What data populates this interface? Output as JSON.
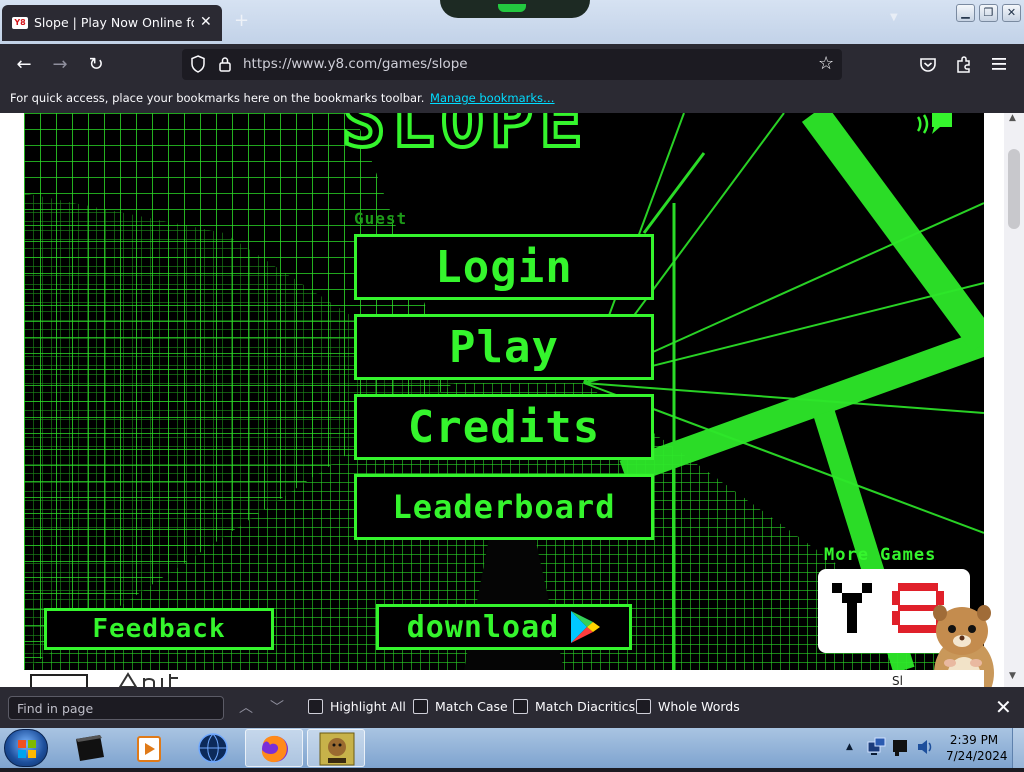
{
  "browser": {
    "tab": {
      "favicon_text": "Y8",
      "title": "Slope | Play Now Online for Free",
      "close_glyph": "✕"
    },
    "new_tab_glyph": "+",
    "window_controls": {
      "minimize": "▁",
      "restore": "❐",
      "close": "✕"
    },
    "nav": {
      "back": "←",
      "forward": "→",
      "reload": "↻"
    },
    "url": "https://www.y8.com/games/slope",
    "bookmark_star": "☆",
    "toolbar_icons": [
      "pocket-icon",
      "extensions-icon",
      "menu-icon"
    ],
    "bookmarks_bar": {
      "message": "For quick access, place your bookmarks here on the bookmarks toolbar.",
      "link": "Manage bookmarks…"
    }
  },
  "game": {
    "logo": "SLOPE",
    "guest_label": "Guest",
    "menu": {
      "login": "Login",
      "play": "Play",
      "credits": "Credits",
      "leaderboard": "Leaderboard"
    },
    "feedback": "Feedback",
    "download": "download",
    "more_games": "More Games",
    "colors": {
      "neon": "#35f52d",
      "background": "#000000"
    }
  },
  "below_game": {
    "right_text": "Sl"
  },
  "find_bar": {
    "placeholder": "Find in page",
    "options": [
      "Highlight All",
      "Match Case",
      "Match Diacritics",
      "Whole Words"
    ]
  },
  "taskbar": {
    "clock_time": "2:39 PM",
    "clock_date": "7/24/2024"
  }
}
